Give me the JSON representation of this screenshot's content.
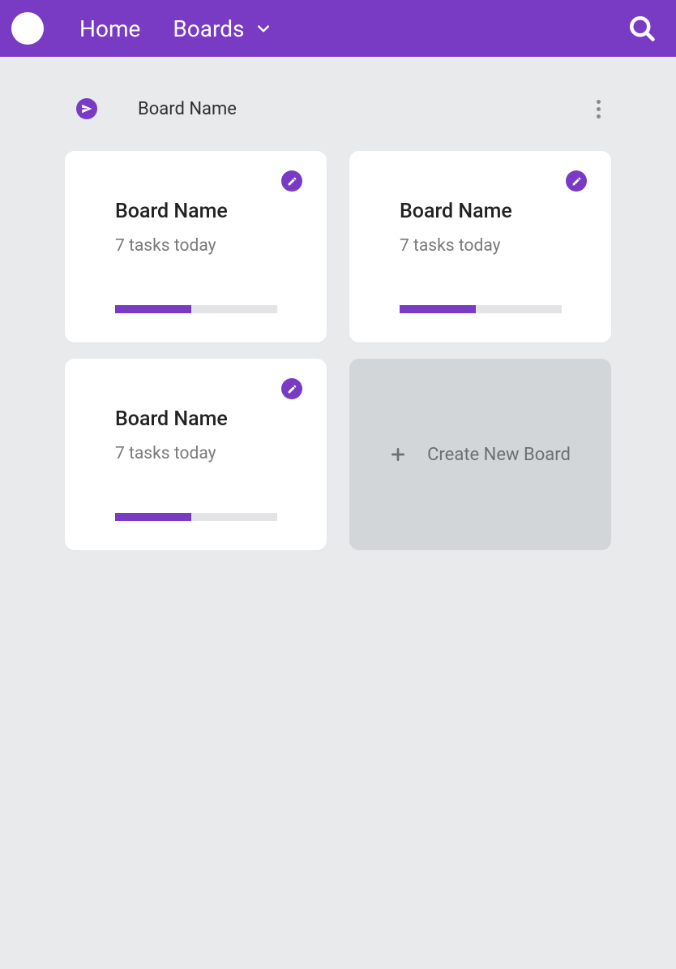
{
  "colors": {
    "accent": "#7a3bc4",
    "page_bg": "#e9eaec",
    "card_bg": "#ffffff",
    "create_bg": "#d3d6d9"
  },
  "nav": {
    "home_label": "Home",
    "boards_label": "Boards"
  },
  "section": {
    "icon": "paper-plane-icon",
    "title": "Board Name"
  },
  "boards": [
    {
      "title": "Board Name",
      "subtitle": "7 tasks today",
      "progress": 47
    },
    {
      "title": "Board Name",
      "subtitle": "7 tasks today",
      "progress": 47
    },
    {
      "title": "Board Name",
      "subtitle": "7 tasks today",
      "progress": 47
    }
  ],
  "create": {
    "label": "Create New Board"
  }
}
